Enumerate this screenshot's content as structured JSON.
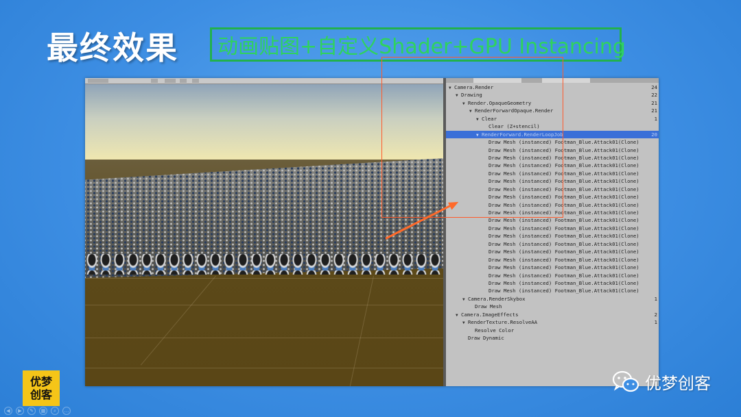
{
  "slide": {
    "title": "最终效果",
    "subtitle": "动画贴图+自定义Shader+GPU Instancing"
  },
  "profiler": {
    "rows": [
      {
        "indent": 0,
        "expand": "▼",
        "label": "Camera.Render",
        "count": "24"
      },
      {
        "indent": 1,
        "expand": "▼",
        "label": "Drawing",
        "count": "22"
      },
      {
        "indent": 2,
        "expand": "▼",
        "label": "Render.OpaqueGeometry",
        "count": "21"
      },
      {
        "indent": 3,
        "expand": "▼",
        "label": "RenderForwardOpaque.Render",
        "count": "21"
      },
      {
        "indent": 4,
        "expand": "▼",
        "label": "Clear",
        "count": "1"
      },
      {
        "indent": 5,
        "expand": "",
        "label": "Clear (Z+stencil)",
        "count": ""
      },
      {
        "indent": 4,
        "expand": "▼",
        "label": "RenderForward.RenderLoopJob",
        "count": "20",
        "selected": true
      },
      {
        "indent": 5,
        "expand": "",
        "label": "Draw Mesh (instanced) Footman_Blue.Attack01(Clone)",
        "count": ""
      },
      {
        "indent": 5,
        "expand": "",
        "label": "Draw Mesh (instanced) Footman_Blue.Attack01(Clone)",
        "count": ""
      },
      {
        "indent": 5,
        "expand": "",
        "label": "Draw Mesh (instanced) Footman_Blue.Attack01(Clone)",
        "count": ""
      },
      {
        "indent": 5,
        "expand": "",
        "label": "Draw Mesh (instanced) Footman_Blue.Attack01(Clone)",
        "count": ""
      },
      {
        "indent": 5,
        "expand": "",
        "label": "Draw Mesh (instanced) Footman_Blue.Attack01(Clone)",
        "count": ""
      },
      {
        "indent": 5,
        "expand": "",
        "label": "Draw Mesh (instanced) Footman_Blue.Attack01(Clone)",
        "count": ""
      },
      {
        "indent": 5,
        "expand": "",
        "label": "Draw Mesh (instanced) Footman_Blue.Attack01(Clone)",
        "count": ""
      },
      {
        "indent": 5,
        "expand": "",
        "label": "Draw Mesh (instanced) Footman_Blue.Attack01(Clone)",
        "count": ""
      },
      {
        "indent": 5,
        "expand": "",
        "label": "Draw Mesh (instanced) Footman_Blue.Attack01(Clone)",
        "count": ""
      },
      {
        "indent": 5,
        "expand": "",
        "label": "Draw Mesh (instanced) Footman_Blue.Attack01(Clone)",
        "count": ""
      },
      {
        "indent": 5,
        "expand": "",
        "label": "Draw Mesh (instanced) Footman_Blue.Attack01(Clone)",
        "count": ""
      },
      {
        "indent": 5,
        "expand": "",
        "label": "Draw Mesh (instanced) Footman_Blue.Attack01(Clone)",
        "count": ""
      },
      {
        "indent": 5,
        "expand": "",
        "label": "Draw Mesh (instanced) Footman_Blue.Attack01(Clone)",
        "count": ""
      },
      {
        "indent": 5,
        "expand": "",
        "label": "Draw Mesh (instanced) Footman_Blue.Attack01(Clone)",
        "count": ""
      },
      {
        "indent": 5,
        "expand": "",
        "label": "Draw Mesh (instanced) Footman_Blue.Attack01(Clone)",
        "count": ""
      },
      {
        "indent": 5,
        "expand": "",
        "label": "Draw Mesh (instanced) Footman_Blue.Attack01(Clone)",
        "count": ""
      },
      {
        "indent": 5,
        "expand": "",
        "label": "Draw Mesh (instanced) Footman_Blue.Attack01(Clone)",
        "count": ""
      },
      {
        "indent": 5,
        "expand": "",
        "label": "Draw Mesh (instanced) Footman_Blue.Attack01(Clone)",
        "count": ""
      },
      {
        "indent": 5,
        "expand": "",
        "label": "Draw Mesh (instanced) Footman_Blue.Attack01(Clone)",
        "count": ""
      },
      {
        "indent": 5,
        "expand": "",
        "label": "Draw Mesh (instanced) Footman_Blue.Attack01(Clone)",
        "count": ""
      },
      {
        "indent": 2,
        "expand": "▼",
        "label": "Camera.RenderSkybox",
        "count": "1"
      },
      {
        "indent": 3,
        "expand": "",
        "label": "Draw Mesh",
        "count": ""
      },
      {
        "indent": 1,
        "expand": "▼",
        "label": "Camera.ImageEffects",
        "count": "2"
      },
      {
        "indent": 2,
        "expand": "▼",
        "label": "RenderTexture.ResolveAA",
        "count": "1"
      },
      {
        "indent": 3,
        "expand": "",
        "label": "Resolve Color",
        "count": ""
      },
      {
        "indent": 2,
        "expand": "",
        "label": "Draw Dynamic",
        "count": ""
      }
    ]
  },
  "logo": {
    "line1": "优梦",
    "line2": "创客"
  },
  "brand": {
    "name": "优梦创客",
    "icon": "wechat-icon"
  },
  "colors": {
    "background": "#3d8ee3",
    "subtitle": "#2fd35d",
    "highlight": "#ff5a2a",
    "selection": "#3a6fd8",
    "logo": "#f5c518"
  }
}
